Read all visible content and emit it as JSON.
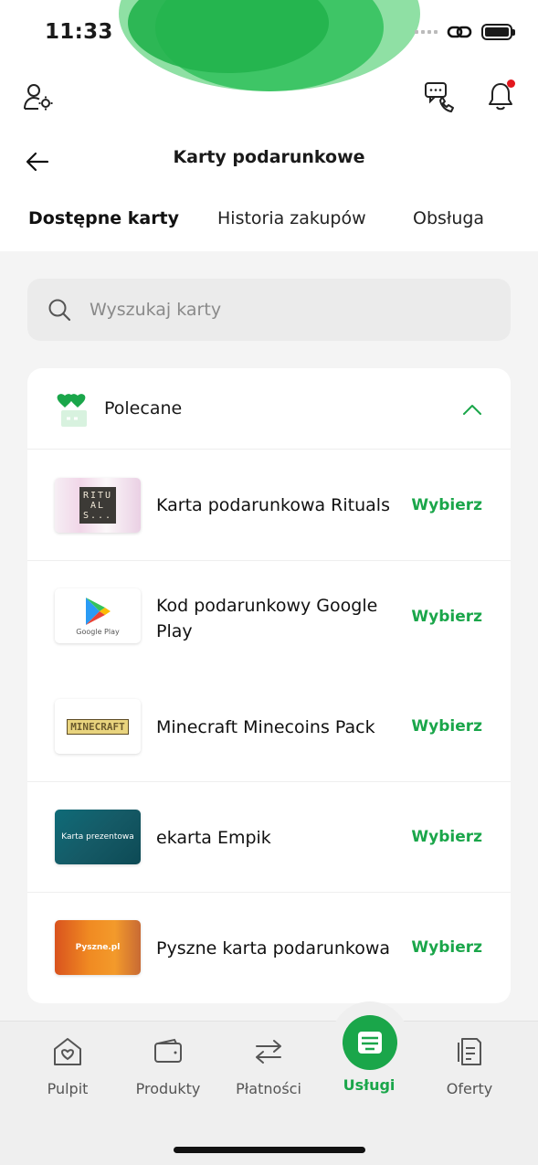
{
  "status_bar": {
    "time": "11:33"
  },
  "header": {
    "title": "Karty podarunkowe"
  },
  "tabs": [
    {
      "label": "Dostępne karty",
      "active": true
    },
    {
      "label": "Historia zakupów",
      "active": false
    },
    {
      "label": "Obsługa",
      "active": false
    }
  ],
  "search": {
    "placeholder": "Wyszukaj karty"
  },
  "section": {
    "title": "Polecane",
    "expanded": true,
    "items": [
      {
        "name": "Karta podarunkowa Rituals",
        "action": "Wybierz",
        "logo_text": "RITUALS..."
      },
      {
        "name": "Kod podarunkowy Google Play",
        "action": "Wybierz",
        "logo_text": "Google Play"
      },
      {
        "name": "Minecraft Minecoins Pack",
        "action": "Wybierz",
        "logo_text": "MINECRAFT"
      },
      {
        "name": "ekarta Empik",
        "action": "Wybierz",
        "logo_text": "Karta prezentowa"
      },
      {
        "name": "Pyszne karta podarunkowa",
        "action": "Wybierz",
        "logo_text": "Pyszne.pl"
      }
    ]
  },
  "bottom_nav": [
    {
      "label": "Pulpit",
      "icon": "home-heart-icon",
      "active": false
    },
    {
      "label": "Produkty",
      "icon": "wallet-icon",
      "active": false
    },
    {
      "label": "Płatności",
      "icon": "transfer-arrows-icon",
      "active": false
    },
    {
      "label": "Usługi",
      "icon": "services-icon",
      "active": true
    },
    {
      "label": "Oferty",
      "icon": "offers-document-icon",
      "active": false
    }
  ],
  "colors": {
    "accent": "#1aa64a",
    "notification": "#e3171e"
  }
}
